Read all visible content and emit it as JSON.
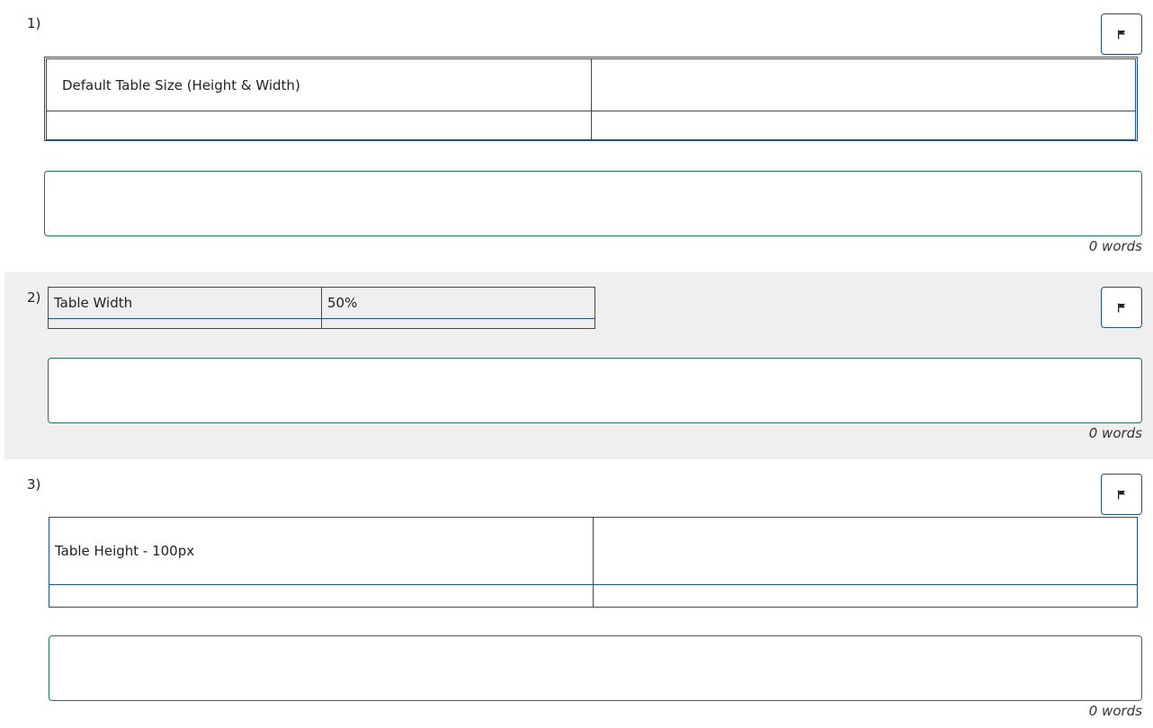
{
  "questions": [
    {
      "number": "1)",
      "table": {
        "rows": [
          [
            "Default Table Size (Height & Width)",
            ""
          ],
          [
            "",
            ""
          ]
        ]
      },
      "word_count": "0 words"
    },
    {
      "number": "2)",
      "table": {
        "rows": [
          [
            "Table Width",
            "50%"
          ],
          [
            "",
            ""
          ]
        ]
      },
      "word_count": "0 words"
    },
    {
      "number": "3)",
      "table": {
        "rows": [
          [
            "Table Height - 100px",
            ""
          ],
          [
            "",
            ""
          ]
        ]
      },
      "word_count": "0 words"
    }
  ],
  "flag_icon": "flag-icon",
  "colors": {
    "table_border": "#1a4f8a",
    "answer_border": "#1c7560",
    "highlight_bg": "#efefef"
  }
}
